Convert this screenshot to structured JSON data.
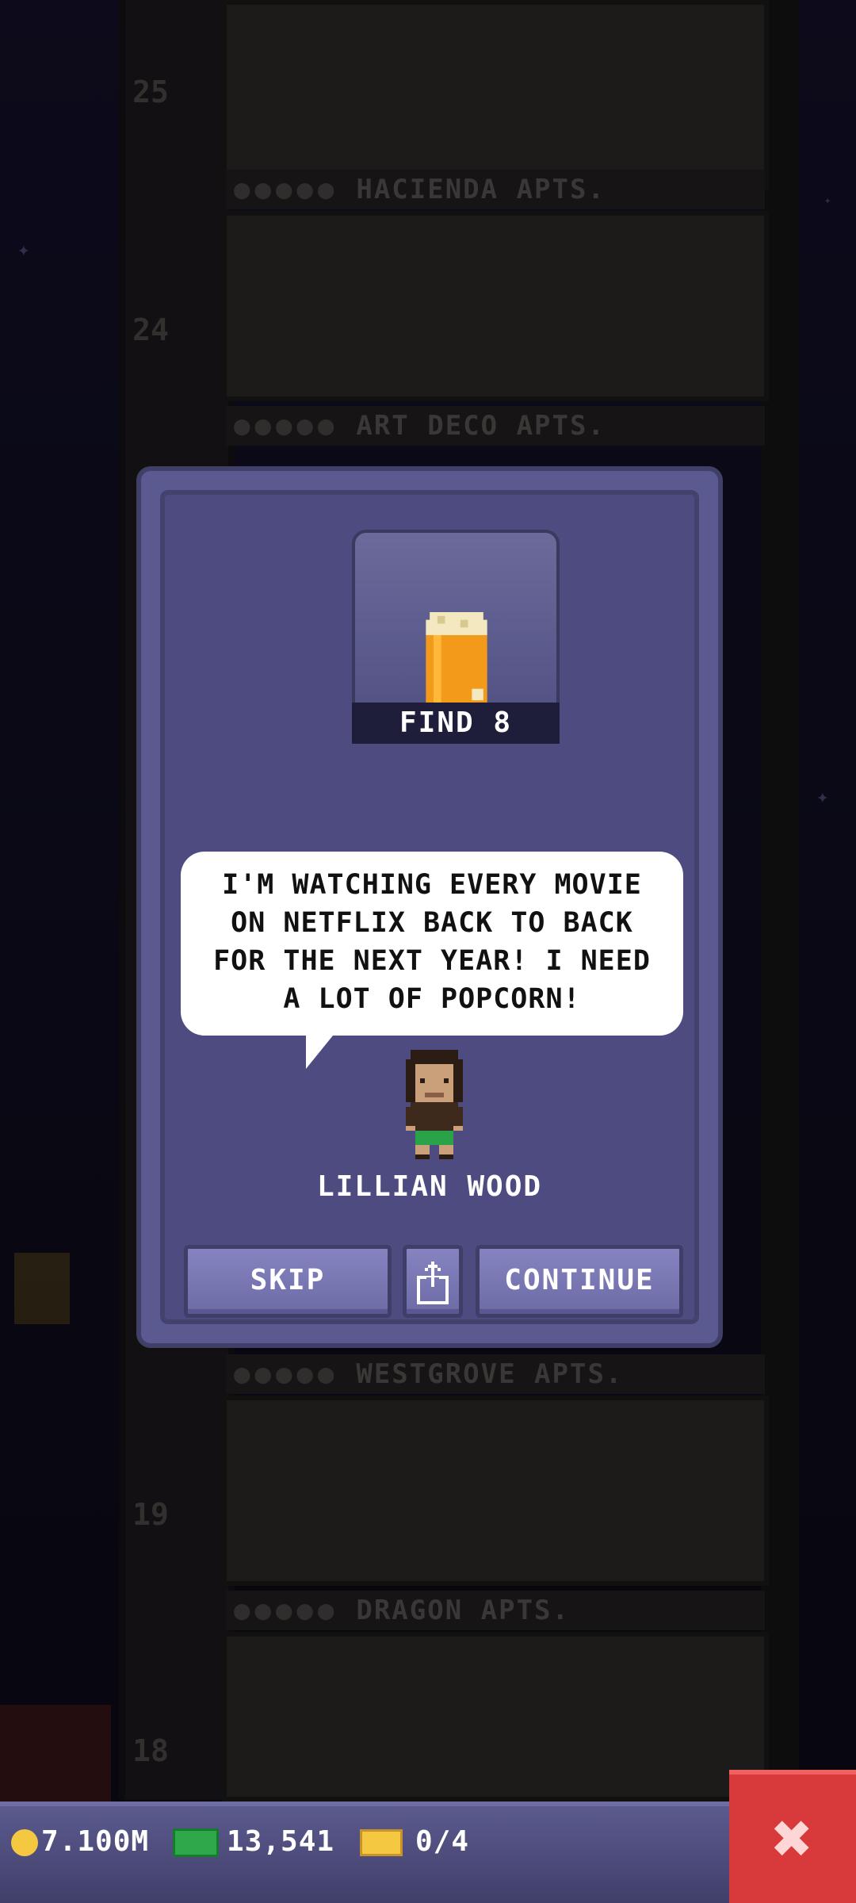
{
  "floors": [
    {
      "number": "25",
      "name": "HACIENDA APTS."
    },
    {
      "number": "24",
      "name": "ART DECO APTS."
    },
    {
      "number": "",
      "name": "WESTGROVE APTS."
    },
    {
      "number": "19",
      "name": "DRAGON APTS."
    },
    {
      "number": "18",
      "name": ""
    }
  ],
  "quest": {
    "item_icon": "popcorn-icon",
    "find_label": "FIND 8",
    "speech_lines": [
      "I'M WATCHING EVERY MOVIE",
      "ON NETFLIX BACK TO BACK",
      "FOR THE NEXT YEAR! I NEED",
      "A LOT OF POPCORN!"
    ],
    "npc_name": "LILLIAN WOOD"
  },
  "buttons": {
    "skip": "SKIP",
    "share_icon": "share-icon",
    "continue": "CONTINUE"
  },
  "status_bar": {
    "coins": "7.100M",
    "bux": "13,541",
    "tickets": "0/4"
  },
  "colors": {
    "dialog": "#4d4b80",
    "button": "#7b79b4",
    "close": "#d8393a",
    "coin": "#f5c842",
    "bux": "#2ea84a"
  }
}
